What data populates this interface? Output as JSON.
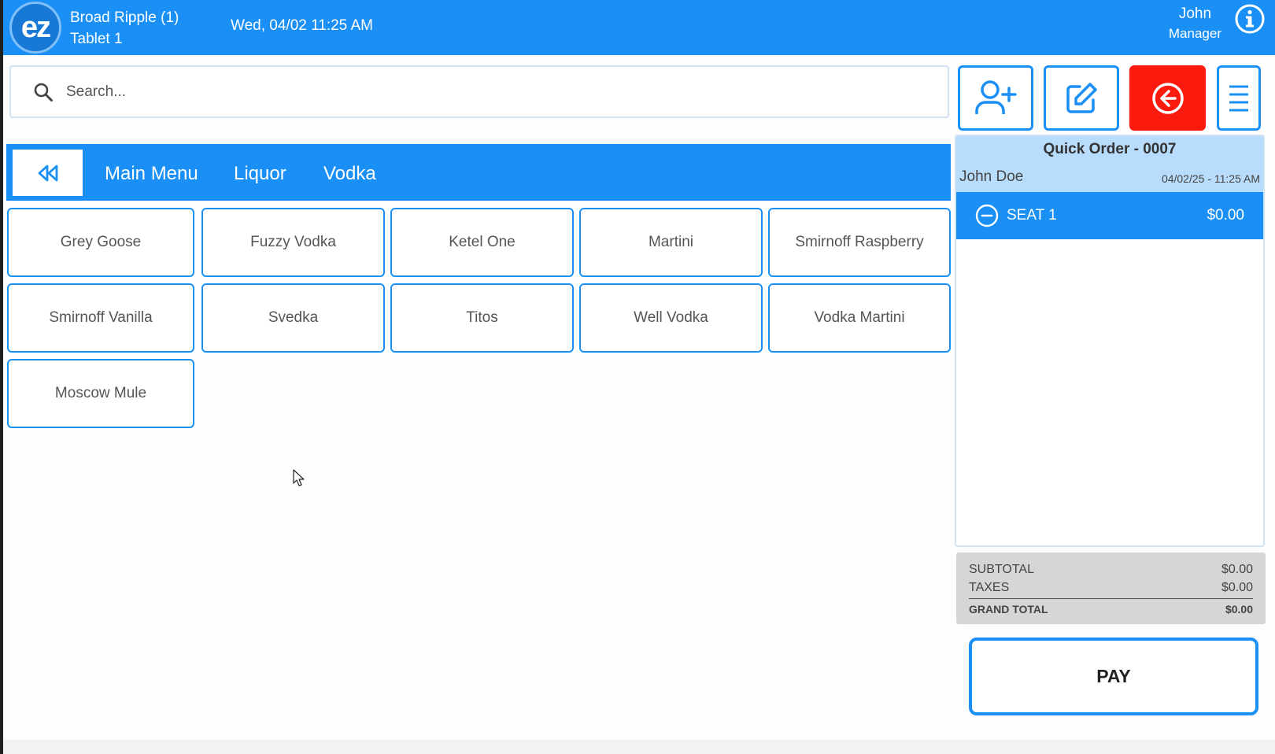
{
  "header": {
    "logo_text": "ez",
    "store_name": "Broad Ripple (1)",
    "device_name": "Tablet 1",
    "datetime": "Wed, 04/02 11:25 AM",
    "user_name": "John",
    "user_role": "Manager",
    "info_icon": "info-circle-icon"
  },
  "search": {
    "placeholder": "Search...",
    "value": ""
  },
  "actions": [
    {
      "name": "add-customer",
      "icon": "user-plus-icon"
    },
    {
      "name": "edit-order",
      "icon": "edit-icon"
    },
    {
      "name": "exit",
      "icon": "arrow-left-circle-icon",
      "color": "#fb1b0e"
    },
    {
      "name": "menu",
      "icon": "hamburger-icon"
    }
  ],
  "breadcrumb": {
    "back_icon": "double-chevron-left-icon",
    "items": [
      "Main Menu",
      "Liquor",
      "Vodka"
    ]
  },
  "items": [
    "Grey Goose",
    "Fuzzy Vodka",
    "Ketel One",
    "Martini",
    "Smirnoff Raspberry",
    "Smirnoff Vanilla",
    "Svedka",
    "Titos",
    "Well Vodka",
    "Vodka Martini",
    "Moscow Mule"
  ],
  "order": {
    "title": "Quick Order - 0007",
    "customer": "John Doe",
    "timestamp": "04/02/25 - 11:25 AM",
    "seat": {
      "label": "SEAT 1",
      "amount": "$0.00",
      "icon": "minus-circle-icon"
    }
  },
  "totals": {
    "subtotal_label": "SUBTOTAL",
    "subtotal": "$0.00",
    "taxes_label": "TAXES",
    "taxes": "$0.00",
    "grand_label": "GRAND TOTAL",
    "grand": "$0.00"
  },
  "pay_label": "PAY",
  "colors": {
    "primary": "#1a8ff6",
    "danger": "#fb1b0e",
    "light_blue": "#b8dcfb"
  }
}
